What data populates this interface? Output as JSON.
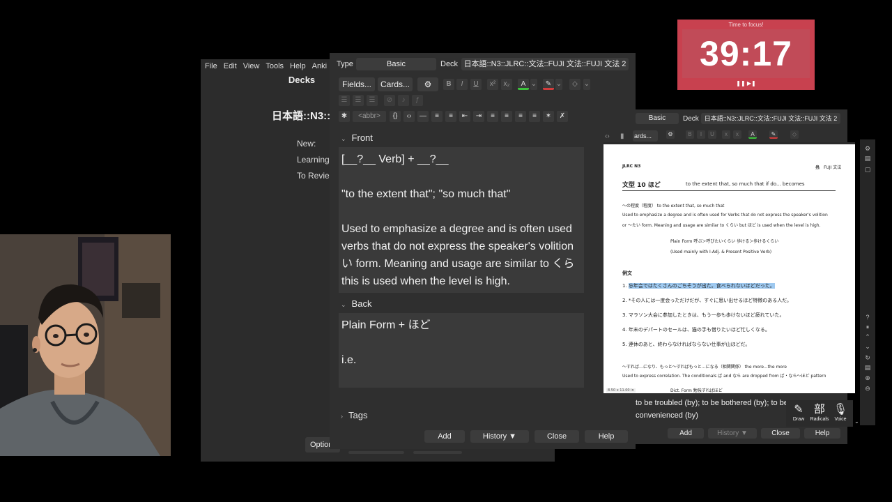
{
  "main_window": {
    "menu": [
      "File",
      "Edit",
      "View",
      "Tools",
      "Help",
      "Anki"
    ],
    "decks_title": "Decks",
    "deck_name": "日本語::N3::",
    "stats": [
      "New:",
      "Learning",
      "To Revie"
    ],
    "options_label": "Option"
  },
  "add_window": {
    "type_label": "Type",
    "type_value": "Basic",
    "deck_label": "Deck",
    "deck_value": "日本語::N3::JLRC::文法::FUJI 文法::FUJI 文法 2",
    "fields_btn": "Fields...",
    "cards_btn": "Cards...",
    "abbr_btn": "<abbr>",
    "front_label": "Front",
    "front_lines": [
      "[__?__ Verb] + __?__",
      "",
      "\"to the extent that\"; \"so much that\"",
      "",
      "Used to emphasize a degree and is often used",
      "verbs that do not express the speaker's volition",
      "い form. Meaning and usage are similar to くら",
      "this is used when the level is high."
    ],
    "back_label": "Back",
    "back_lines": [
      "Plain Form + ほど",
      "",
      "i.e."
    ],
    "tags_label": "Tags",
    "buttons": {
      "add": "Add",
      "history": "History ▼",
      "close": "Close",
      "help": "Help"
    }
  },
  "add_window_2": {
    "type_value": "Basic",
    "deck_label": "Deck",
    "deck_value": "日本語::N3::JLRC::文法::FUJI 文法::FUJI 文法 2",
    "cards_btn": "ards...",
    "back_text": [
      "to be troubled (by); to be bothered (by); to be",
      "convenienced (by)"
    ],
    "buttons": {
      "add": "Add",
      "history": "History ▼",
      "close": "Close",
      "help": "Help"
    }
  },
  "tools": {
    "draw": "Draw",
    "radicals": "Radicals",
    "voice": "Voice",
    "radicals_glyph": "部"
  },
  "timer": {
    "caption": "Time to focus!",
    "time": "39:17",
    "controls": "❚❚ ▶❚"
  },
  "document": {
    "header_left": "JLRC N3",
    "header_right": "FUJI 文法",
    "header_right_mark": "蟲",
    "pattern_title": "文型 10 ほど",
    "pattern_gloss": "to the extent that, so much that    if do... becomes",
    "sec1_title": "～の程度（程度）     to the extent that, so much that",
    "sec1_body1": "Used to emphasize a degree and is often used for Verbs that do not express the speaker's volition",
    "sec1_body2": "or ～たい form. Meaning and usage are similar to くらい but ほど is used when the level is high.",
    "form_line1": "Plain Form       呼ぶ＞呼びたいくらい      歩ける＞歩けるくらい",
    "form_line2": "(Used mainly with I-Adj. & Present Positive Verb)",
    "examples_title": "例文",
    "ex1_num": "1.",
    "ex1": "忘年会ではたくさんのごちそうが出た。食べられないほどだった。",
    "ex2": "2. *その人には一度会っただけだが、すぐに思い出せるほど特徴のある人だ。",
    "ex3": "3. マラソン大会に参加したときは、もう一歩も歩けないほど疲れていた。",
    "ex4": "4. 年末のデパートのセールは、猫の手も借りたいほど忙しくなる。",
    "ex5": "5. 連休のあと、終わらなければならない仕事が山ほどだ。",
    "sec2_title": "～すれば…になり、もっと～すればもっと…になる（相関関係）   the more...the more",
    "sec2_body": "Used to express correlation. The conditionals ば and なら are dropped from ば・なら～ほど pattern",
    "cut_line": "Dict. Form         勉強すればほど",
    "page_size": "8.50 x 11.00 in"
  },
  "colors": {
    "timer_bg": "#c8414f",
    "window_bg": "#2f2f2f",
    "field_bg": "#3a3a3a",
    "highlight": "#9ec9f0"
  }
}
